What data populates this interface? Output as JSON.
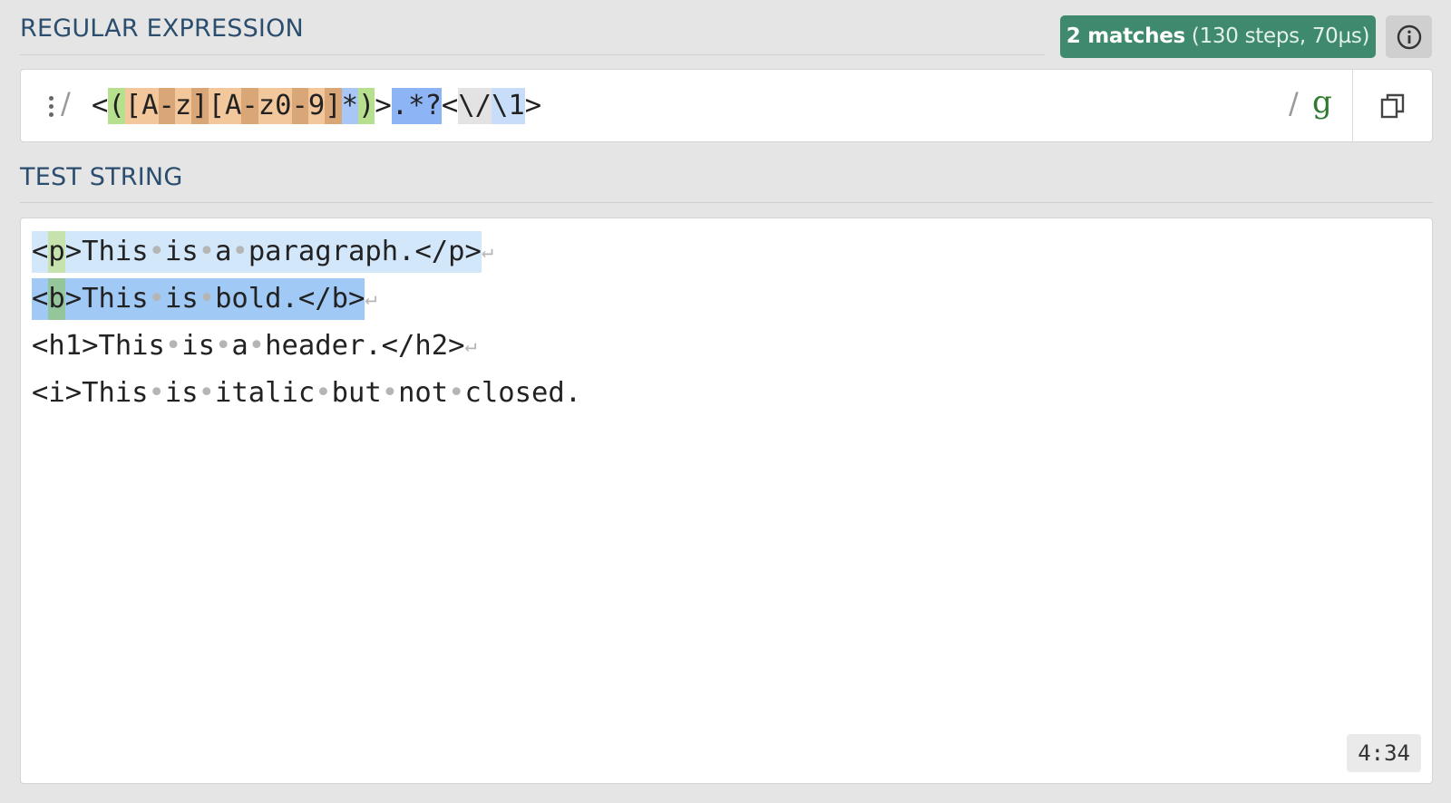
{
  "regex_section": {
    "title": "REGULAR EXPRESSION",
    "match_count": "2 matches",
    "match_detail": " (130 steps, 70µs)",
    "info_icon": "info-icon",
    "delimiter_left": "/",
    "pattern_tokens": [
      {
        "text": "<",
        "kind": "plain"
      },
      {
        "text": "(",
        "kind": "group"
      },
      {
        "text": "[",
        "kind": "set"
      },
      {
        "text": "A",
        "kind": "set"
      },
      {
        "text": "-",
        "kind": "setc"
      },
      {
        "text": "z",
        "kind": "set"
      },
      {
        "text": "]",
        "kind": "setc"
      },
      {
        "text": "[",
        "kind": "set"
      },
      {
        "text": "A",
        "kind": "set"
      },
      {
        "text": "-",
        "kind": "setc"
      },
      {
        "text": "z",
        "kind": "set"
      },
      {
        "text": "0",
        "kind": "set"
      },
      {
        "text": "-",
        "kind": "setc"
      },
      {
        "text": "9",
        "kind": "set"
      },
      {
        "text": "]",
        "kind": "setc"
      },
      {
        "text": "*",
        "kind": "quant"
      },
      {
        "text": ")",
        "kind": "group"
      },
      {
        "text": ">",
        "kind": "plain"
      },
      {
        "text": ".*?",
        "kind": "dot"
      },
      {
        "text": "<",
        "kind": "plain"
      },
      {
        "text": "\\/",
        "kind": "esc"
      },
      {
        "text": "\\1",
        "kind": "back"
      },
      {
        "text": ">",
        "kind": "plain"
      }
    ],
    "delimiter_right": "/",
    "flags": "g",
    "copy_icon": "copy-icon",
    "menu_icon": "kebab-menu-icon"
  },
  "test_section": {
    "title": "TEST STRING",
    "lines": [
      {
        "match": 1,
        "segments": [
          {
            "text": "<",
            "kind": "m"
          },
          {
            "text": "p",
            "kind": "g"
          },
          {
            "text": ">This",
            "kind": "m"
          },
          {
            "text": "•",
            "kind": "mws"
          },
          {
            "text": "is",
            "kind": "m"
          },
          {
            "text": "•",
            "kind": "mws"
          },
          {
            "text": "a",
            "kind": "m"
          },
          {
            "text": "•",
            "kind": "mws"
          },
          {
            "text": "paragraph.</p>",
            "kind": "m"
          },
          {
            "text": "↵",
            "kind": "nl"
          }
        ]
      },
      {
        "match": 2,
        "segments": [
          {
            "text": "<",
            "kind": "m"
          },
          {
            "text": "b",
            "kind": "g"
          },
          {
            "text": ">This",
            "kind": "m"
          },
          {
            "text": "•",
            "kind": "mws"
          },
          {
            "text": "is",
            "kind": "m"
          },
          {
            "text": "•",
            "kind": "mws"
          },
          {
            "text": "bold.</b>",
            "kind": "m"
          },
          {
            "text": "↵",
            "kind": "nl"
          }
        ]
      },
      {
        "match": 0,
        "segments": [
          {
            "text": "<h1>This",
            "kind": "t"
          },
          {
            "text": "•",
            "kind": "ws"
          },
          {
            "text": "is",
            "kind": "t"
          },
          {
            "text": "•",
            "kind": "ws"
          },
          {
            "text": "a",
            "kind": "t"
          },
          {
            "text": "•",
            "kind": "ws"
          },
          {
            "text": "header.</h2>",
            "kind": "t"
          },
          {
            "text": "↵",
            "kind": "nl"
          }
        ]
      },
      {
        "match": 0,
        "segments": [
          {
            "text": "<i>This",
            "kind": "t"
          },
          {
            "text": "•",
            "kind": "ws"
          },
          {
            "text": "is",
            "kind": "t"
          },
          {
            "text": "•",
            "kind": "ws"
          },
          {
            "text": "italic",
            "kind": "t"
          },
          {
            "text": "•",
            "kind": "ws"
          },
          {
            "text": "but",
            "kind": "t"
          },
          {
            "text": "•",
            "kind": "ws"
          },
          {
            "text": "not",
            "kind": "t"
          },
          {
            "text": "•",
            "kind": "ws"
          },
          {
            "text": "closed.",
            "kind": "t"
          }
        ]
      }
    ],
    "cursor_position": "4:34"
  },
  "colors": {
    "match_badge": "#3f8a6e",
    "section_title": "#2b4d6e",
    "flag": "#2f7a2f"
  }
}
